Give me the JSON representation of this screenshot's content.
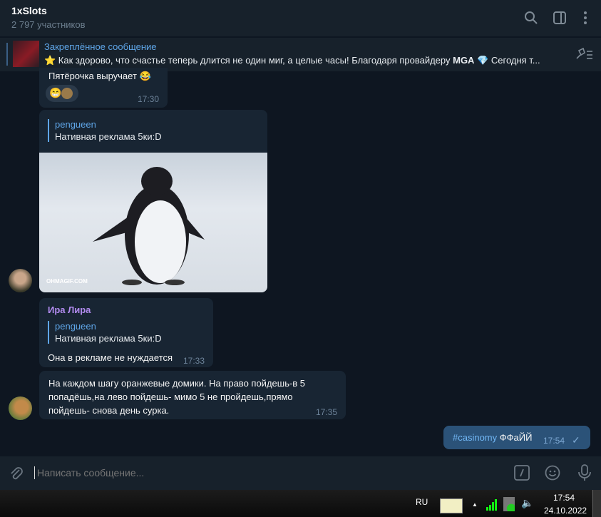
{
  "header": {
    "title": "1xSlots",
    "subtitle": "2 797 участников"
  },
  "pinned": {
    "label": "Закреплённое сообщение",
    "text_pre": "⭐ Как здорово, что счастье теперь длится не один миг, а целые часы! Благодаря провайдеру ",
    "text_bold": "MGA",
    "text_post": " 💎  Сегодня т..."
  },
  "messages": [
    {
      "text": "Пятёрочка выручает 😂",
      "reactions": "😁",
      "time": "17:30"
    },
    {
      "reply_name": "pengueen",
      "reply_text": "Нативная реклама 5ки:D",
      "gif_watermark": "OHMAGIF.COM"
    },
    {
      "sender": "Ира Лира",
      "reply_name": "pengueen",
      "reply_text": "Нативная реклама 5ки:D",
      "text": "Она в рекламе не нуждается",
      "time": "17:33"
    },
    {
      "text": "На каждом шагу оранжевые домики. На право пойдешь-в 5 попадёшь,на лево пойдешь- мимо  5 не пройдешь,прямо пойдешь- снова день сурка.",
      "time": "17:35"
    },
    {
      "hashtag": "#casinomy",
      "text": " ФФаЙЙ",
      "time": "17:54",
      "status": "✓"
    }
  ],
  "input": {
    "placeholder": "Написать сообщение..."
  },
  "taskbar": {
    "lang": "RU",
    "time": "17:54",
    "date": "24.10.2022"
  }
}
